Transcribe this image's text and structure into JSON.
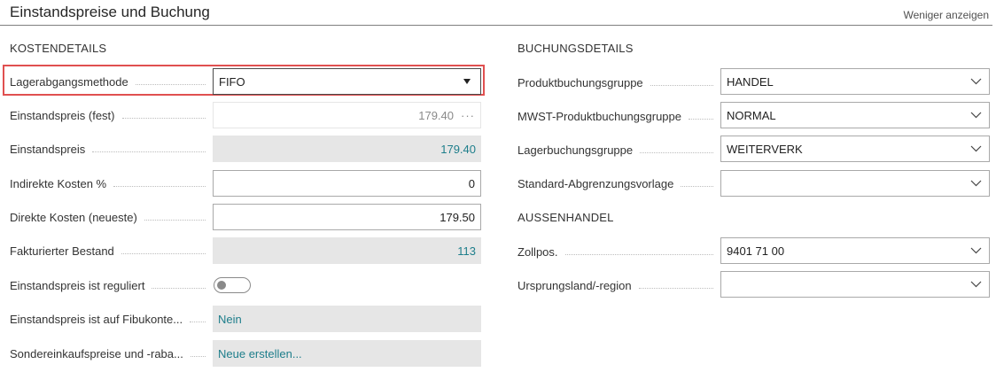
{
  "header": {
    "title": "Einstandspreise und Buchung",
    "toggle_label": "Weniger anzeigen"
  },
  "kosten": {
    "title": "KOSTENDETAILS",
    "rows": [
      {
        "label": "Lagerabgangsmethode",
        "value": "FIFO"
      },
      {
        "label": "Einstandspreis (fest)",
        "value": "179.40"
      },
      {
        "label": "Einstandspreis",
        "value": "179.40"
      },
      {
        "label": "Indirekte Kosten %",
        "value": "0"
      },
      {
        "label": "Direkte Kosten (neueste)",
        "value": "179.50"
      },
      {
        "label": "Fakturierter Bestand",
        "value": "113"
      },
      {
        "label": "Einstandspreis ist reguliert",
        "value": ""
      },
      {
        "label": "Einstandspreis ist auf Fibukonte...",
        "value": "Nein"
      },
      {
        "label": "Sondereinkaufspreise und -raba...",
        "value": "Neue erstellen..."
      }
    ]
  },
  "buchung": {
    "title": "BUCHUNGSDETAILS",
    "rows": [
      {
        "label": "Produktbuchungsgruppe",
        "value": "HANDEL"
      },
      {
        "label": "MWST-Produktbuchungsgruppe",
        "value": "NORMAL"
      },
      {
        "label": "Lagerbuchungsgruppe",
        "value": "WEITERVERK"
      },
      {
        "label": "Standard-Abgrenzungsvorlage",
        "value": ""
      }
    ]
  },
  "aussenhandel": {
    "title": "AUSSENHANDEL",
    "rows": [
      {
        "label": "Zollpos.",
        "value": "9401 71 00"
      },
      {
        "label": "Ursprungsland/-region",
        "value": ""
      }
    ]
  },
  "icons": {
    "dropdown_solid": "caret-down-icon",
    "dropdown_outline": "chevron-down-icon",
    "lookup": "ellipsis-icon"
  },
  "colors": {
    "link_teal": "#1e7e8b",
    "highlight": "#e05050",
    "readonly_bg": "#e6e6e6"
  }
}
